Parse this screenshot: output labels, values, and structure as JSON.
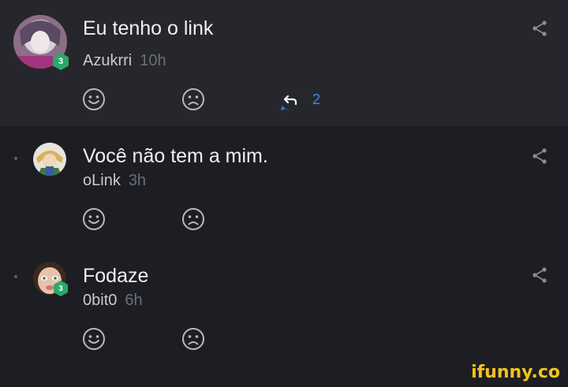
{
  "comments": [
    {
      "text": "Eu tenho o link",
      "author": "Azukrri",
      "time": "10h",
      "level": "3",
      "replies": "2"
    },
    {
      "text": "Você não tem a mim.",
      "author": "oLink",
      "time": "3h"
    },
    {
      "text": "Fodaze",
      "author": "0bit0",
      "time": "6h",
      "level": "3"
    }
  ],
  "watermark": "ifunny.co",
  "colors": {
    "background": "#1d1e24",
    "highlight_row": "#26272c",
    "level_badge": "#2aa86a",
    "reply_accent": "#2f7de6"
  }
}
